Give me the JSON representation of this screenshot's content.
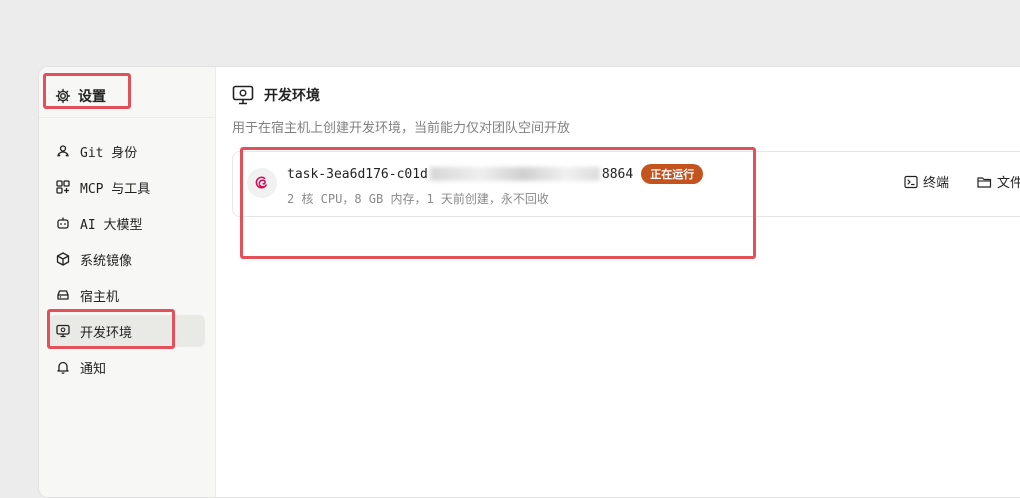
{
  "sidebar": {
    "header": {
      "label": "设置",
      "icon": "gear-icon"
    },
    "items": [
      {
        "label": "Git 身份",
        "icon": "git-identity-icon"
      },
      {
        "label": "MCP 与工具",
        "icon": "mcp-tools-icon"
      },
      {
        "label": "AI 大模型",
        "icon": "robot-icon"
      },
      {
        "label": "系统镜像",
        "icon": "cube-icon"
      },
      {
        "label": "宿主机",
        "icon": "host-server-icon"
      },
      {
        "label": "开发环境",
        "icon": "monitor-icon",
        "active": true
      },
      {
        "label": "通知",
        "icon": "bell-icon"
      }
    ]
  },
  "main": {
    "title": "开发环境",
    "title_icon": "monitor-icon",
    "subtitle": "用于在宿主机上创建开发环境，当前能力仅对团队空间开放",
    "environment": {
      "name_prefix": "task-3ea6d176-c01d",
      "name_suffix": "8864",
      "status": "正在运行",
      "spec": "2 核 CPU，8 GB 内存，1 天前创建，永不回收",
      "os_icon": "debian-icon",
      "actions": {
        "terminal": "终端",
        "files": "文件",
        "more": "⋮"
      }
    }
  },
  "colors": {
    "status_badge": "#c4531e",
    "highlight": "#e3505a",
    "debian_red": "#d70751"
  }
}
